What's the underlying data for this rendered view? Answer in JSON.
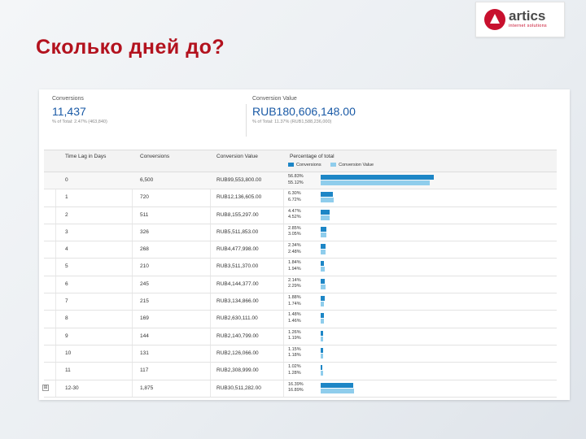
{
  "slide": {
    "title": "Сколько дней до?"
  },
  "logo": {
    "name": "artics",
    "tagline": "internet solutions"
  },
  "summary": {
    "conversions": {
      "title": "Conversions",
      "value": "11,437",
      "sub": "% of Total: 2.47% (463,840)"
    },
    "conversion_value": {
      "title": "Conversion Value",
      "value": "RUB180,606,148.00",
      "sub": "% of Total: 11.37% (RUB1,588,236,000)"
    }
  },
  "table": {
    "headers": [
      "Time Lag in Days",
      "Conversions",
      "Conversion Value",
      "Percentage of total"
    ],
    "legend": [
      {
        "label": "Conversions",
        "color": "#1d86c6"
      },
      {
        "label": "Conversion Value",
        "color": "#8fcdec"
      }
    ],
    "rows": [
      {
        "day": "0",
        "conversions": "6,500",
        "value": "RUB99,553,800.00",
        "pct_conv": "56.83%",
        "pct_val": "55.12%"
      },
      {
        "day": "1",
        "conversions": "720",
        "value": "RUB12,136,605.00",
        "pct_conv": "6.30%",
        "pct_val": "6.72%"
      },
      {
        "day": "2",
        "conversions": "511",
        "value": "RUB8,155,297.00",
        "pct_conv": "4.47%",
        "pct_val": "4.52%"
      },
      {
        "day": "3",
        "conversions": "326",
        "value": "RUB5,511,853.00",
        "pct_conv": "2.85%",
        "pct_val": "3.05%"
      },
      {
        "day": "4",
        "conversions": "268",
        "value": "RUB4,477,998.00",
        "pct_conv": "2.34%",
        "pct_val": "2.48%"
      },
      {
        "day": "5",
        "conversions": "210",
        "value": "RUB3,511,370.00",
        "pct_conv": "1.84%",
        "pct_val": "1.94%"
      },
      {
        "day": "6",
        "conversions": "245",
        "value": "RUB4,144,377.00",
        "pct_conv": "2.14%",
        "pct_val": "2.29%"
      },
      {
        "day": "7",
        "conversions": "215",
        "value": "RUB3,134,866.00",
        "pct_conv": "1.88%",
        "pct_val": "1.74%"
      },
      {
        "day": "8",
        "conversions": "169",
        "value": "RUB2,630,111.00",
        "pct_conv": "1.48%",
        "pct_val": "1.46%"
      },
      {
        "day": "9",
        "conversions": "144",
        "value": "RUB2,140,799.00",
        "pct_conv": "1.26%",
        "pct_val": "1.19%"
      },
      {
        "day": "10",
        "conversions": "131",
        "value": "RUB2,126,066.00",
        "pct_conv": "1.15%",
        "pct_val": "1.18%"
      },
      {
        "day": "11",
        "conversions": "117",
        "value": "RUB2,308,999.00",
        "pct_conv": "1.02%",
        "pct_val": "1.28%"
      },
      {
        "day": "12-30",
        "conversions": "1,875",
        "value": "RUB30,511,282.00",
        "pct_conv": "16.39%",
        "pct_val": "16.89%"
      }
    ]
  },
  "chart_data": {
    "type": "bar",
    "categories": [
      "0",
      "1",
      "2",
      "3",
      "4",
      "5",
      "6",
      "7",
      "8",
      "9",
      "10",
      "11",
      "12-30"
    ],
    "series": [
      {
        "name": "Conversions",
        "values": [
          56.83,
          6.3,
          4.47,
          2.85,
          2.34,
          1.84,
          2.14,
          1.88,
          1.48,
          1.26,
          1.15,
          1.02,
          16.39
        ]
      },
      {
        "name": "Conversion Value",
        "values": [
          55.12,
          6.72,
          4.52,
          3.05,
          2.48,
          1.94,
          2.29,
          1.74,
          1.46,
          1.19,
          1.18,
          1.28,
          16.89
        ]
      }
    ],
    "orientation": "horizontal",
    "xlim": [
      0,
      100
    ]
  }
}
